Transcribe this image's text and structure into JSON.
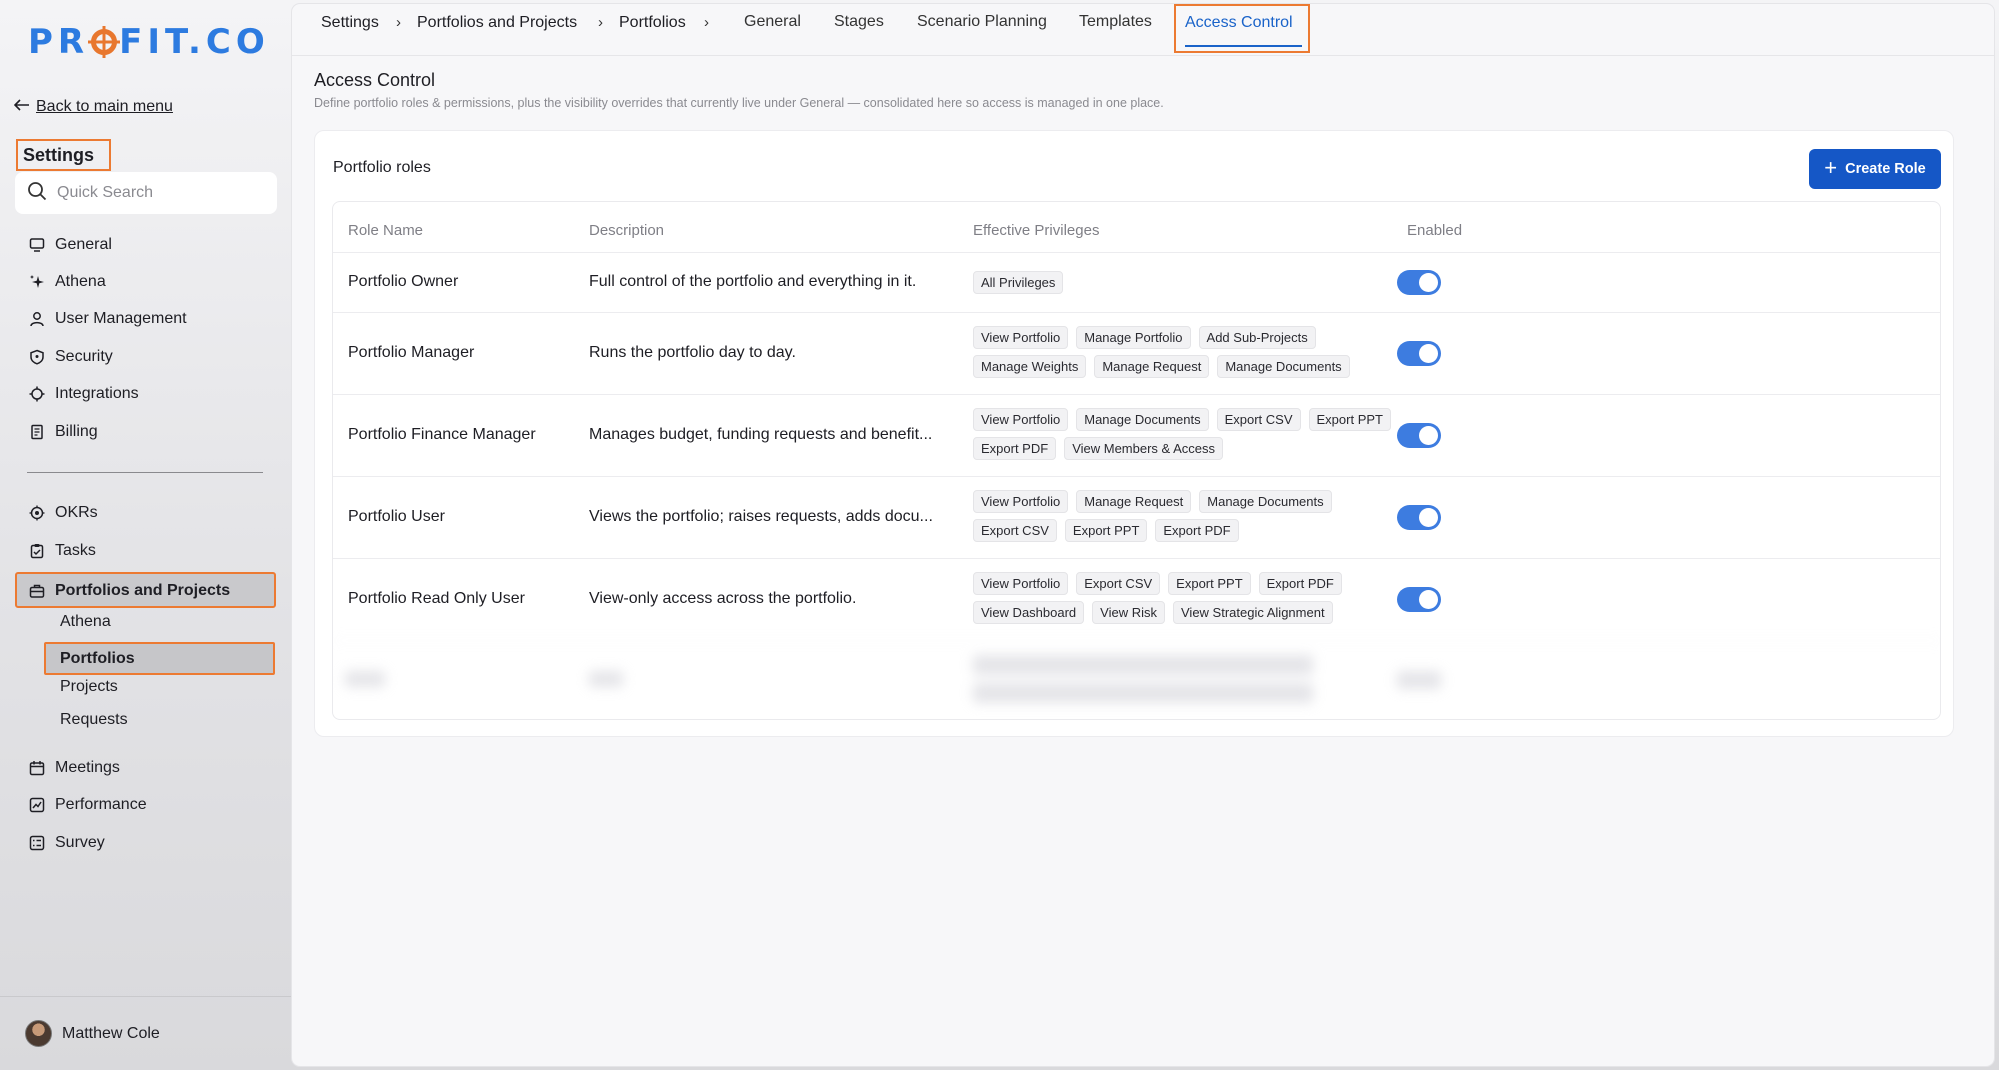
{
  "sidebar": {
    "logo": "PROFIT.CO",
    "back_label": "Back to main menu",
    "settings_title": "Settings",
    "search_placeholder": "Quick Search",
    "items_top": [
      {
        "label": "General",
        "icon": "monitor-icon"
      },
      {
        "label": "Athena",
        "icon": "sparkle-icon"
      },
      {
        "label": "User Management",
        "icon": "user-icon"
      },
      {
        "label": "Security",
        "icon": "shield-icon"
      },
      {
        "label": "Integrations",
        "icon": "puzzle-icon"
      },
      {
        "label": "Billing",
        "icon": "receipt-icon"
      }
    ],
    "items_apps": [
      {
        "label": "OKRs",
        "icon": "target-icon"
      },
      {
        "label": "Tasks",
        "icon": "clipboard-check-icon"
      },
      {
        "label": "Portfolios and Projects",
        "icon": "briefcase-icon"
      }
    ],
    "sub_items": [
      "Athena",
      "Portfolios",
      "Projects",
      "Requests"
    ],
    "items_bottom": [
      {
        "label": "Meetings",
        "icon": "calendar-icon"
      },
      {
        "label": "Performance",
        "icon": "chart-line-icon"
      },
      {
        "label": "Survey",
        "icon": "survey-icon"
      }
    ],
    "user_name": "Matthew Cole"
  },
  "breadcrumb": [
    "Settings",
    "Portfolios and Projects",
    "Portfolios"
  ],
  "tabs": [
    "General",
    "Stages",
    "Scenario Planning",
    "Templates",
    "Access Control"
  ],
  "active_tab": "Access Control",
  "page": {
    "title": "Access Control",
    "subtitle": "Define portfolio roles & permissions, plus the visibility overrides that currently live under General — consolidated here so access is managed in one place."
  },
  "roles_card": {
    "title": "Portfolio roles",
    "create_button": "Create Role",
    "columns": [
      "Role Name",
      "Description",
      "Effective Privileges",
      "Enabled"
    ],
    "rows": [
      {
        "name": "Portfolio Owner",
        "description": "Full control of the portfolio and everything in it.",
        "privileges": [
          "All Privileges"
        ],
        "enabled": true
      },
      {
        "name": "Portfolio Manager",
        "description": "Runs the portfolio day to day.",
        "privileges": [
          "View Portfolio",
          "Manage Portfolio",
          "Add Sub-Projects",
          "Manage Weights",
          "Manage Request",
          "Manage Documents"
        ],
        "enabled": true
      },
      {
        "name": "Portfolio Finance Manager",
        "description": "Manages budget, funding requests and benefit...",
        "privileges": [
          "View Portfolio",
          "Manage Documents",
          "Export CSV",
          "Export PPT",
          "Export PDF",
          "View Members & Access"
        ],
        "enabled": true
      },
      {
        "name": "Portfolio User",
        "description": "Views the portfolio; raises requests, adds docu...",
        "privileges": [
          "View Portfolio",
          "Manage Request",
          "Manage Documents",
          "Export CSV",
          "Export PPT",
          "Export PDF"
        ],
        "enabled": true
      },
      {
        "name": "Portfolio Read Only User",
        "description": "View-only access across the portfolio.",
        "privileges": [
          "View Portfolio",
          "Export CSV",
          "Export PPT",
          "Export PDF",
          "View Dashboard",
          "View Risk",
          "View Strategic Alignment"
        ],
        "enabled": true
      }
    ]
  },
  "colors": {
    "accent": "#1557c6",
    "highlight": "#ec7a32",
    "toggle_on": "#3d7ce0"
  }
}
